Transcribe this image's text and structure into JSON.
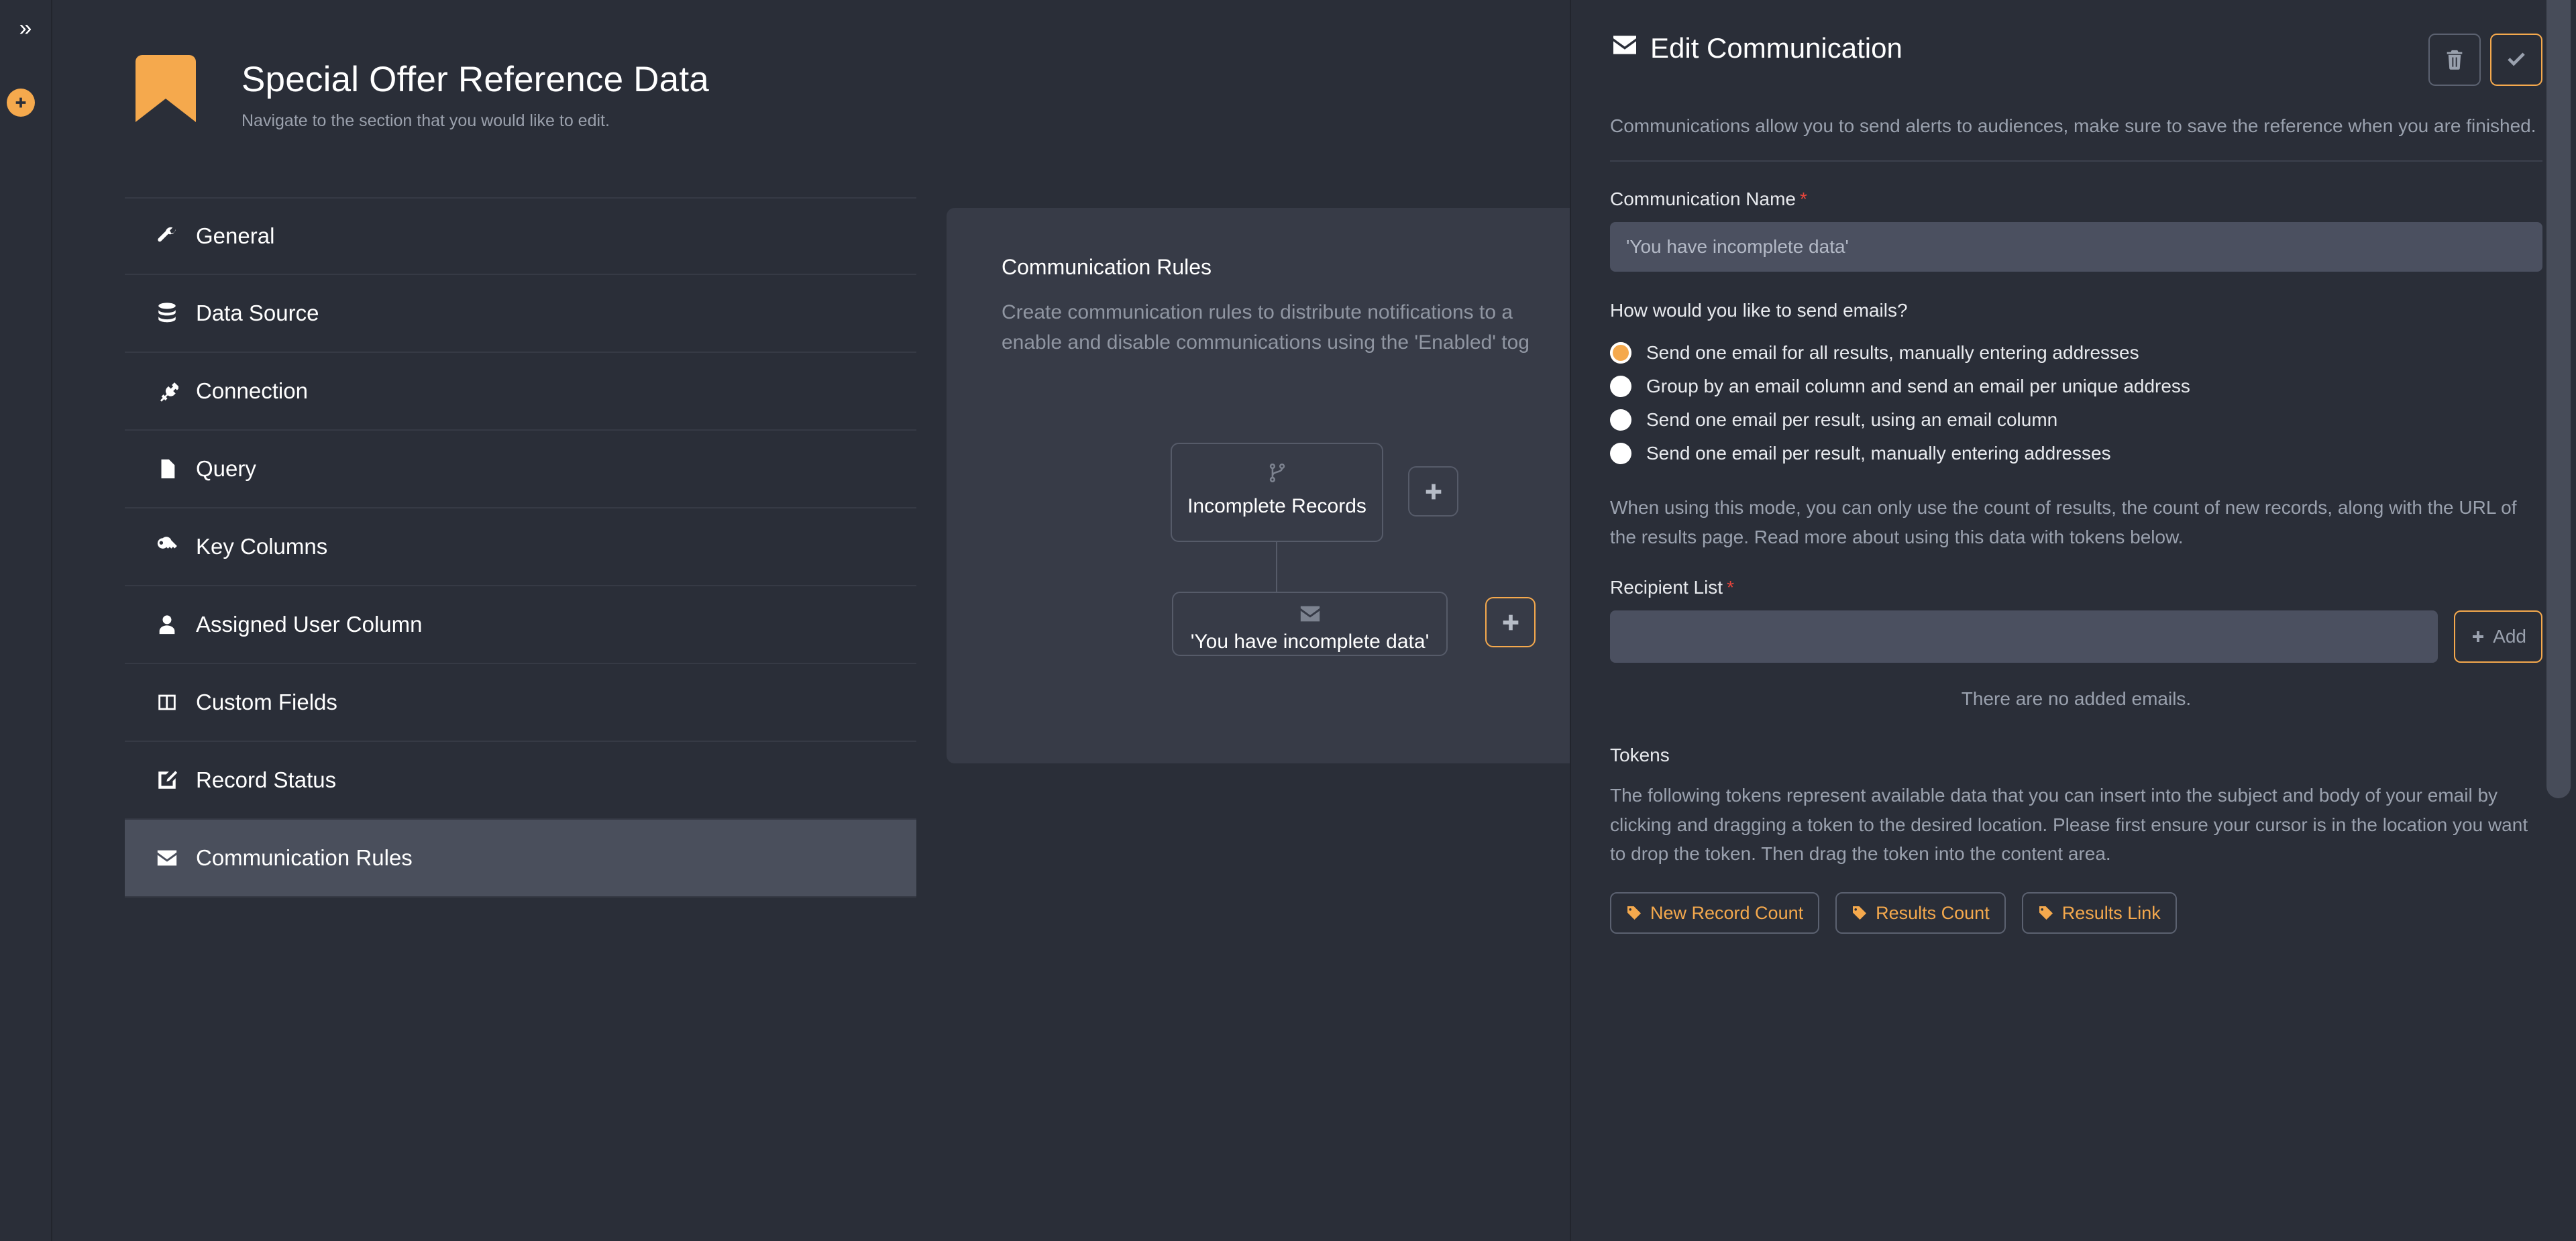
{
  "rail": {
    "collapse_icon": "chevron-double-right-icon",
    "collapse_label": "»",
    "add_icon": "plus-circle-icon"
  },
  "reference": {
    "icon": "bookmark-icon",
    "title": "Special Offer Reference Data",
    "subtitle": "Navigate to the section that you would like to edit.",
    "nav_items": [
      {
        "label": "General",
        "icon": "wrench-icon",
        "active": false
      },
      {
        "label": "Data Source",
        "icon": "database-icon",
        "active": false
      },
      {
        "label": "Connection",
        "icon": "plug-icon",
        "active": false
      },
      {
        "label": "Query",
        "icon": "file-icon",
        "active": false
      },
      {
        "label": "Key Columns",
        "icon": "key-icon",
        "active": false
      },
      {
        "label": "Assigned User Column",
        "icon": "user-icon",
        "active": false
      },
      {
        "label": "Custom Fields",
        "icon": "columns-icon",
        "active": false
      },
      {
        "label": "Record Status",
        "icon": "edit-square-icon",
        "active": false
      },
      {
        "label": "Communication Rules",
        "icon": "envelope-icon",
        "active": true
      }
    ]
  },
  "center": {
    "title": "Communication Rules",
    "description": "Create communication rules to distribute notifications to a\nenable and disable communications using the 'Enabled' tog",
    "nodes": [
      {
        "label": "Incomplete Records",
        "icon": "code-branch-icon"
      },
      {
        "label": "'You have incomplete data'",
        "icon": "envelope-icon"
      }
    ],
    "add_rule_button": {
      "icon": "plus-icon",
      "accent": false
    },
    "add_comm_button": {
      "icon": "plus-icon",
      "accent": true
    }
  },
  "edit_panel": {
    "icon": "envelope-icon",
    "title": "Edit Communication",
    "delete_button": {
      "icon": "trash-icon",
      "label": ""
    },
    "save_button": {
      "icon": "check-icon",
      "label": ""
    },
    "description": "Communications allow you to send alerts to audiences, make sure to save the reference when you are finished.",
    "name_field": {
      "label": "Communication Name",
      "required_marker": "*",
      "value": "",
      "placeholder": "'You have incomplete data'"
    },
    "send_mode": {
      "question": "How would you like to send emails?",
      "options": [
        {
          "label": "Send one email for all results, manually entering addresses",
          "selected": true
        },
        {
          "label": "Group by an email column and send an email per unique address",
          "selected": false
        },
        {
          "label": "Send one email per result, using an email column",
          "selected": false
        },
        {
          "label": "Send one email per result, manually entering addresses",
          "selected": false
        }
      ],
      "note": "When using this mode, you can only use the count of results, the count of new records, along with the URL of the results page. Read more about using this data with tokens below."
    },
    "recipient_list": {
      "label": "Recipient List",
      "required_marker": "*",
      "value": "",
      "placeholder": "",
      "add_label": "Add",
      "add_icon": "plus-icon",
      "empty_message": "There are no added emails."
    },
    "tokens": {
      "title": "Tokens",
      "description": "The following tokens represent available data that you can insert into the subject and body of your email by clicking and dragging a token to the desired location. Please first ensure your cursor is in the location you want to drop the token. Then drag the token into the content area.",
      "items": [
        {
          "label": "New Record Count",
          "icon": "tag-icon"
        },
        {
          "label": "Results Count",
          "icon": "tag-icon"
        },
        {
          "label": "Results Link",
          "icon": "tag-icon"
        }
      ]
    }
  },
  "colors": {
    "accent": "#f5a94d",
    "page_bg": "#2a2e38",
    "card_bg": "#373b47",
    "input_bg": "#4b5060",
    "required": "#e8453c",
    "muted_text": "#9aa1ae"
  }
}
